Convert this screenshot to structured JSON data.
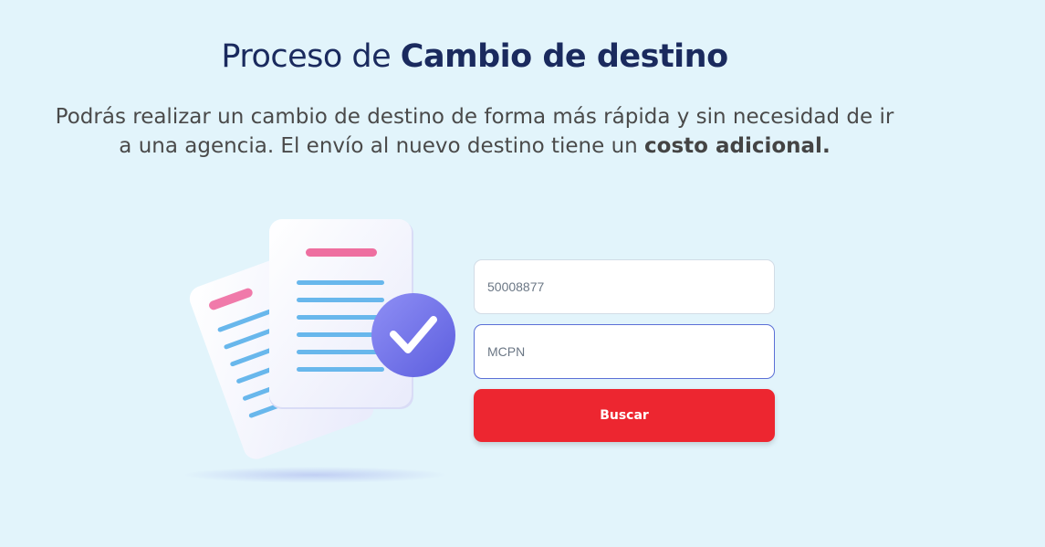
{
  "header": {
    "title_regular": "Proceso de ",
    "title_bold": "Cambio de destino"
  },
  "intro": {
    "text_regular": "Podrás realizar un cambio de destino de forma más rápida y sin necesidad de ir a una agencia. El envío al nuevo destino tiene un ",
    "text_bold": "costo adicional."
  },
  "form": {
    "field1_value": "50008877",
    "field2_value": "MCPN",
    "submit_label": "Buscar"
  },
  "colors": {
    "background": "#e2f4fb",
    "title": "#1a2a5e",
    "button": "#ed2630",
    "focus_border": "#5b6fd6"
  },
  "illustration": {
    "icon": "documents-check-icon"
  }
}
